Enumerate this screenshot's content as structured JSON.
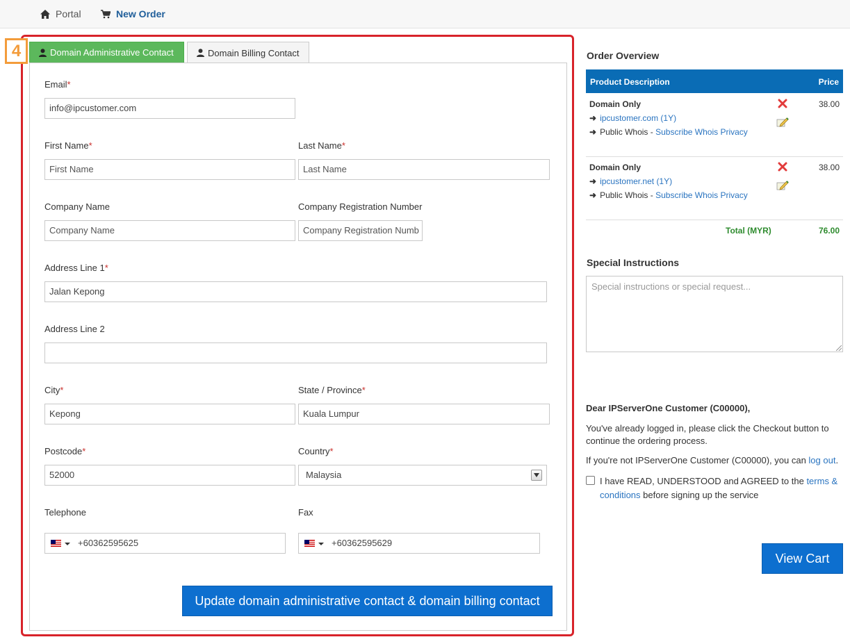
{
  "breadcrumb": {
    "portal": "Portal",
    "new_order": "New Order"
  },
  "step_badge": "4",
  "tabs": {
    "admin": "Domain Administrative Contact",
    "billing": "Domain Billing Contact"
  },
  "form": {
    "email": {
      "label": "Email",
      "value": "info@ipcustomer.com"
    },
    "first_name": {
      "label": "First Name",
      "placeholder": "First Name"
    },
    "last_name": {
      "label": "Last Name",
      "placeholder": "Last Name"
    },
    "company_name": {
      "label": "Company Name",
      "placeholder": "Company Name"
    },
    "company_reg": {
      "label": "Company Registration Number",
      "placeholder": "Company Registration Numb"
    },
    "address1": {
      "label": "Address Line 1",
      "value": "Jalan Kepong"
    },
    "address2": {
      "label": "Address Line 2",
      "value": ""
    },
    "city": {
      "label": "City",
      "value": "Kepong"
    },
    "state": {
      "label": "State / Province",
      "value": "Kuala Lumpur"
    },
    "postcode": {
      "label": "Postcode",
      "value": "52000"
    },
    "country": {
      "label": "Country",
      "value": "Malaysia"
    },
    "telephone": {
      "label": "Telephone",
      "value": "+60362595625"
    },
    "fax": {
      "label": "Fax",
      "value": "+60362595629"
    },
    "required_mark": "*",
    "update_button": "Update domain administrative contact & domain billing contact"
  },
  "order_overview": {
    "title": "Order Overview",
    "col_description": "Product Description",
    "col_price": "Price",
    "items": [
      {
        "name": "Domain Only",
        "domain": "ipcustomer.com (1Y)",
        "whois_prefix": "Public Whois - ",
        "whois_link": "Subscribe Whois Privacy",
        "price": "38.00"
      },
      {
        "name": "Domain Only",
        "domain": "ipcustomer.net (1Y)",
        "whois_prefix": "Public Whois - ",
        "whois_link": "Subscribe Whois Privacy",
        "price": "38.00"
      }
    ],
    "total_label": "Total (MYR)",
    "total_value": "76.00"
  },
  "special_instructions": {
    "title": "Special Instructions",
    "placeholder": "Special instructions or special request..."
  },
  "checkout": {
    "dear": "Dear IPServerOne Customer (C00000),",
    "line1": "You've already logged in, please click the Checkout button to continue the ordering process.",
    "line2_prefix": "If you're not IPServerOne Customer (C00000), you can ",
    "line2_link": "log out",
    "line2_suffix": ".",
    "agree_prefix": "I have READ, UNDERSTOOD and AGREED to the ",
    "agree_link": "terms & conditions",
    "agree_suffix": " before signing up the service",
    "view_cart": "View Cart"
  },
  "colors": {
    "accent_blue": "#0d6fcf",
    "tab_green": "#5cb85c",
    "highlight_red": "#d8232a",
    "badge_orange": "#f39c3b",
    "total_green": "#2e8b2e"
  }
}
